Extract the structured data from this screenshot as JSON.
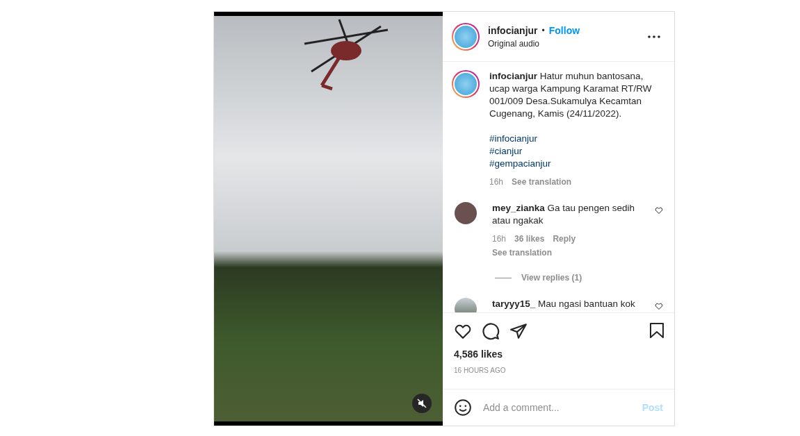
{
  "post": {
    "username": "infocianjur",
    "follow": "Follow",
    "separator": "•",
    "audio": "Original audio",
    "muted": true
  },
  "caption": {
    "username": "infocianjur",
    "text": "Hatur muhun bantosana, ucap warga Kampung Karamat RT/RW 001/009 Desa.Sukamulya Kecamtan Cugenang, Kamis (24/11/2022).",
    "hashtags": [
      "#infocianjur",
      "#cianjur",
      "#gempacianjur"
    ],
    "time": "16h",
    "translate": "See translation"
  },
  "comments": [
    {
      "username": "mey_zianka",
      "text": "Ga tau pengen sedih atau ngakak",
      "time": "16h",
      "likes": "36 likes",
      "reply": "Reply",
      "translate": "See translation",
      "view_replies": "View replies (1)",
      "liked": false
    },
    {
      "username": "taryyy15_",
      "text": "Mau ngasi bantuan kok",
      "liked": false
    }
  ],
  "likes": "4,586 likes",
  "posted": "16 HOURS AGO",
  "add_comment": {
    "placeholder": "Add a comment...",
    "post": "Post"
  }
}
